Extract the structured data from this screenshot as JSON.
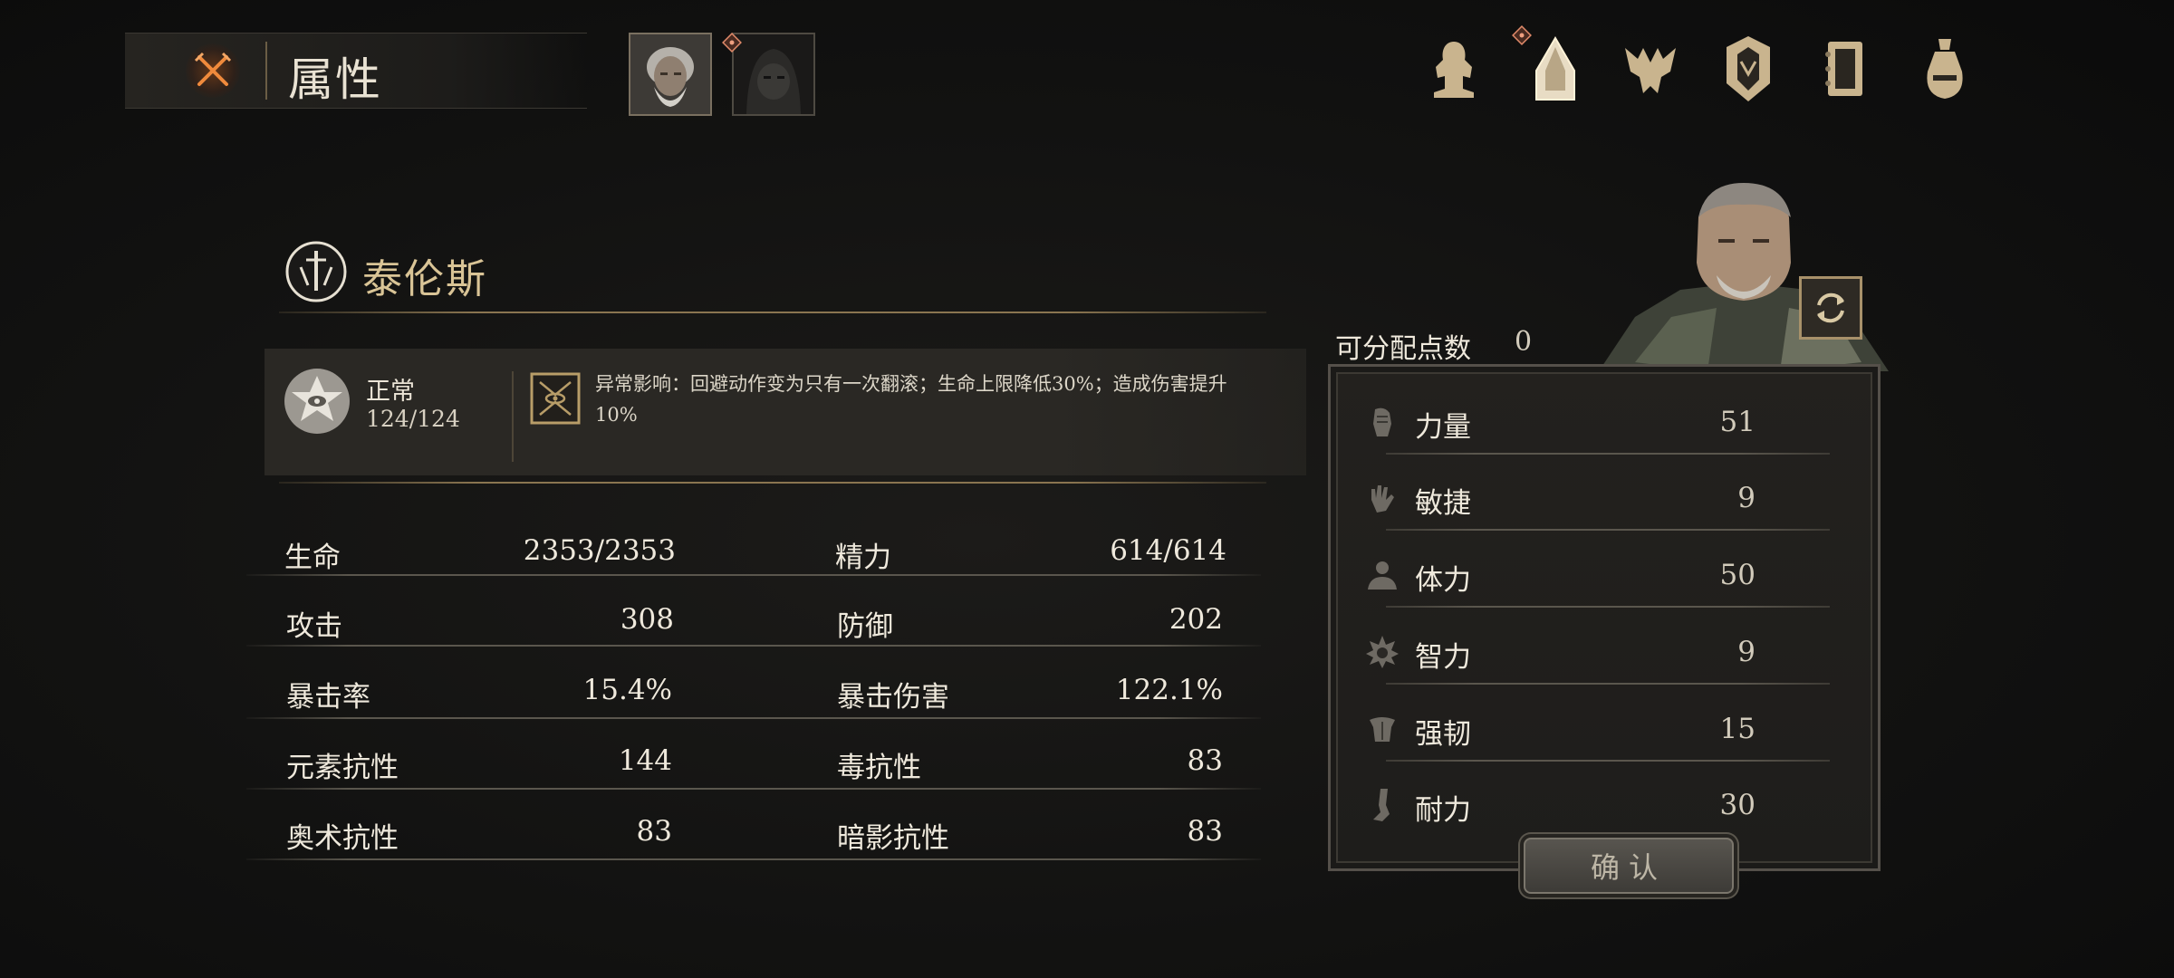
{
  "header": {
    "title": "属性",
    "close_icon": "crossed-swords-icon",
    "accent_color": "#e07a33"
  },
  "party_tabs": [
    {
      "name": "portrait-tab-grey-haired-hero",
      "selected": true
    },
    {
      "name": "portrait-tab-hooded-companion",
      "selected": false
    }
  ],
  "nav_icons": [
    "equipment-icon",
    "attributes-icon",
    "skills-icon",
    "emblem-icon",
    "journal-icon",
    "bag-icon"
  ],
  "character": {
    "name": "泰伦斯"
  },
  "status": {
    "name": "正常",
    "value": "124/124",
    "effect_text": "异常影响：回避动作变为只有一次翻滚；生命上限降低30%；造成伤害提升10%"
  },
  "stats": {
    "left": [
      {
        "label": "生命",
        "value": "2353/2353"
      },
      {
        "label": "攻击",
        "value": "308"
      },
      {
        "label": "暴击率",
        "value": "15.4%"
      },
      {
        "label": "元素抗性",
        "value": "144"
      },
      {
        "label": "奥术抗性",
        "value": "83"
      }
    ],
    "right": [
      {
        "label": "精力",
        "value": "614/614"
      },
      {
        "label": "防御",
        "value": "202"
      },
      {
        "label": "暴击伤害",
        "value": "122.1%"
      },
      {
        "label": "毒抗性",
        "value": "83"
      },
      {
        "label": "暗影抗性",
        "value": "83"
      }
    ]
  },
  "points": {
    "label": "可分配点数",
    "value": "0"
  },
  "attributes": [
    {
      "label": "力量",
      "value": "51",
      "icon": "fist-icon"
    },
    {
      "label": "敏捷",
      "value": "9",
      "icon": "hand-icon"
    },
    {
      "label": "体力",
      "value": "50",
      "icon": "body-icon"
    },
    {
      "label": "智力",
      "value": "9",
      "icon": "sun-icon"
    },
    {
      "label": "强韧",
      "value": "15",
      "icon": "torso-icon"
    },
    {
      "label": "耐力",
      "value": "30",
      "icon": "leg-icon"
    }
  ],
  "confirm": {
    "label": "确认"
  }
}
